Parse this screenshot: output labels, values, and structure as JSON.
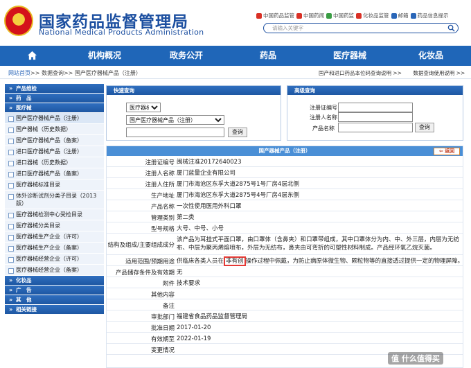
{
  "header": {
    "title_cn": "国家药品监督管理局",
    "title_en": "National Medical Products Administration",
    "top_links": [
      "中国药品监管",
      "中国药闻",
      "中国药监",
      "化妆品监管",
      "邮箱",
      "药品信息提示"
    ],
    "search_placeholder": "请输入关键字"
  },
  "nav": {
    "items": [
      "",
      "机构概况",
      "政务公开",
      "药品",
      "医疗器械",
      "化妆品"
    ]
  },
  "breadcrumb": {
    "home": "网站首页",
    "rest": ">> 数据查询>> 国产医疗器械产品（注册）",
    "right_links": [
      "国产和进口药品本位码查询说明",
      ">>",
      "数据查询使用说明",
      ">>"
    ]
  },
  "sidebar": {
    "sections": [
      {
        "type": "head",
        "label": "产品维检"
      },
      {
        "type": "head",
        "label": "药　品"
      },
      {
        "type": "head",
        "label": "医疗械"
      },
      {
        "type": "item",
        "label": "国产医疗器械产品（注册）",
        "active": true
      },
      {
        "type": "item",
        "label": "国产器械（历史数据）"
      },
      {
        "type": "item",
        "label": "国产医疗器械产品（备案）"
      },
      {
        "type": "item",
        "label": "进口医疗器械产品（注册）"
      },
      {
        "type": "item",
        "label": "进口器械（历史数据）"
      },
      {
        "type": "item",
        "label": "进口医疗器械产品（备案）"
      },
      {
        "type": "item",
        "label": "医疗器械标准目录"
      },
      {
        "type": "item",
        "label": "体外诊断试剂分类子目录（2013版）"
      },
      {
        "type": "item",
        "label": "医疗器械检测中心受检目录"
      },
      {
        "type": "item",
        "label": "医疗器械分类目录"
      },
      {
        "type": "item",
        "label": "医疗器械生产企业（许可）"
      },
      {
        "type": "item",
        "label": "医疗器械生产企业（备案）"
      },
      {
        "type": "item",
        "label": "医疗器械经营企业（许可）"
      },
      {
        "type": "item",
        "label": "医疗器械经营企业（备案）"
      },
      {
        "type": "head",
        "label": "化妆品"
      },
      {
        "type": "head",
        "label": "广　告"
      },
      {
        "type": "head",
        "label": "其　他"
      },
      {
        "type": "head",
        "label": "相关链接"
      }
    ]
  },
  "quick_search": {
    "title": "快速查询",
    "category_value": "医疗器械",
    "subcategory_value": "国产医疗器械产品（注册）",
    "keyword_value": "",
    "button": "查询"
  },
  "advanced_search": {
    "title": "高级查询",
    "fields": [
      "注册证编号",
      "注册人名称",
      "产品名称"
    ],
    "button": "查询"
  },
  "detail": {
    "title": "国产器械产品（注册）",
    "back_label": "返回",
    "rows": [
      {
        "k": "注册证编号",
        "v": "闽械注准20172640023"
      },
      {
        "k": "注册人名称",
        "v": "厦门蓝量企业有限公司"
      },
      {
        "k": "注册人住所",
        "v": "厦门市海沧区东孚大道2875号1号厂房4层北侧"
      },
      {
        "k": "生产地址",
        "v": "厦门市海沧区东孚大道2875号4号厂房4层东侧"
      },
      {
        "k": "产品名称",
        "v": "一次性使用医用外科口罩"
      },
      {
        "k": "管理类别",
        "v": "第二类"
      },
      {
        "k": "型号规格",
        "v": "大号、中号、小号"
      },
      {
        "k": "结构及组成/主要组成成分",
        "v": "该产品为耳挂式平面口罩，由口罩体（含鼻夹）和口罩带组成，其中口罩体分为内、中、外三层，内层为无纺布、中层为聚丙烯熔喷布，外层为无纺布，鼻夹由可弯折的可塑性材料制成。产品经环氧乙烷灭菌。"
      },
      {
        "k": "适用范围/预期用途",
        "v_pre": "供临床各类人员在",
        "v_hl": "非有创",
        "v_post": "操作过程中佩戴，为防止病原体微生物、颗粒物等的直接透过提供一定的物理屏障。"
      },
      {
        "k": "产品储存条件及有效期",
        "v": "无"
      },
      {
        "k": "附件",
        "v": "技术要求"
      },
      {
        "k": "其他内容",
        "v": ""
      },
      {
        "k": "备注",
        "v": ""
      },
      {
        "k": "审批部门",
        "v": "福建省食品药品监督管理局"
      },
      {
        "k": "批准日期",
        "v": "2017-01-20"
      },
      {
        "k": "有效期至",
        "v": "2022-01-19"
      },
      {
        "k": "变更情况",
        "v": ""
      }
    ]
  },
  "watermark": "值 什么值得买",
  "colors": {
    "brand_blue": "#1c4fa0",
    "nav_blue": "#1f66b8",
    "highlight_red": "#e53935"
  }
}
